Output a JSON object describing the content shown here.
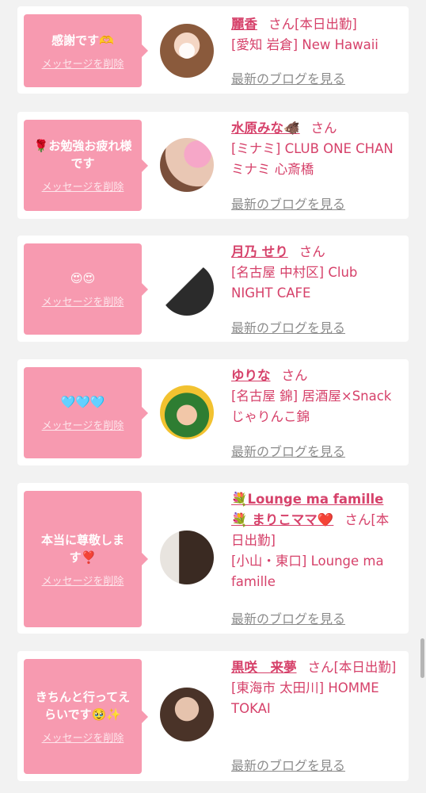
{
  "delete_label": "メッセージを削除",
  "blog_label": "最新のブログを見る",
  "cards": [
    {
      "message": "感謝です🫶",
      "name": "麗香",
      "suffix": "さん[本日出勤]",
      "shop": "[愛知 岩倉] New Hawaii"
    },
    {
      "message": "🌹お勉強お疲れ様です",
      "name": "水原みな🐗",
      "suffix": "さん",
      "shop": "[ミナミ] CLUB ONE CHAN ミナミ 心斎橋"
    },
    {
      "message": "😍😍",
      "name": "月乃 せり",
      "suffix": "さん",
      "shop": "[名古屋 中村区] Club NIGHT CAFE"
    },
    {
      "message": "🩵🩵🩵",
      "name": "ゆりな",
      "suffix": "さん",
      "shop": "[名古屋 錦] 居酒屋×Snack じゃりんこ錦"
    },
    {
      "message": "本当に尊敬します❣️",
      "name": "💐Lounge ma famille💐 まりこママ❤️",
      "suffix": "さん[本日出勤]",
      "shop": "[小山・東口] Lounge ma famille"
    },
    {
      "message": "きちんと行ってえらいです🥹✨",
      "name": "黒咲　来夢",
      "suffix": "さん[本日出勤]",
      "shop": "[東海市 太田川] HOMME TOKAI"
    }
  ],
  "avatar_icon": "profile-photo"
}
